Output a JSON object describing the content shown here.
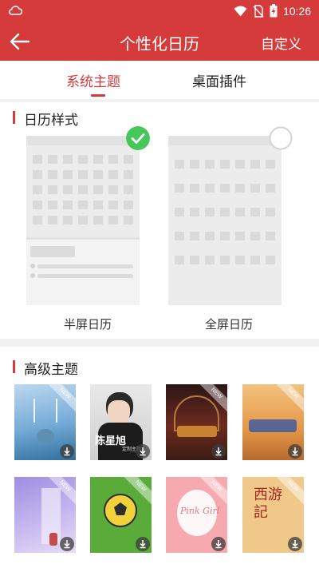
{
  "status_bar": {
    "time": "10:26",
    "icons": [
      "cloud-icon",
      "wifi-icon",
      "no-sim-icon",
      "battery-charging-icon"
    ]
  },
  "app_bar": {
    "title": "个性化日历",
    "back_icon": "arrow-back-icon",
    "custom_label": "自定义"
  },
  "tabs": [
    {
      "label": "系统主题",
      "active": true
    },
    {
      "label": "桌面插件",
      "active": false
    }
  ],
  "calendar_style": {
    "title": "日历样式",
    "options": [
      {
        "label": "半屏日历",
        "selected": true
      },
      {
        "label": "全屏日历",
        "selected": false
      }
    ]
  },
  "premium_themes": {
    "title": "高级主题",
    "items": [
      {
        "name": "theme-blue-art",
        "new": true,
        "text": ""
      },
      {
        "name": "theme-chen-xingxu",
        "new": false,
        "text": "陈星旭",
        "subtext": "定制主题"
      },
      {
        "name": "theme-arena",
        "new": true,
        "text": ""
      },
      {
        "name": "theme-gold-text",
        "new": true,
        "text": ""
      },
      {
        "name": "theme-lavender-window",
        "new": true,
        "text": ""
      },
      {
        "name": "theme-football",
        "new": true,
        "text": ""
      },
      {
        "name": "theme-pink-girl",
        "new": true,
        "text": "Pink Girl"
      },
      {
        "name": "theme-xiyouji",
        "new": true,
        "text": "西游記"
      }
    ],
    "new_badge": "NEW"
  },
  "colors": {
    "primary": "#d63b3b",
    "selected_check": "#47c65a"
  }
}
